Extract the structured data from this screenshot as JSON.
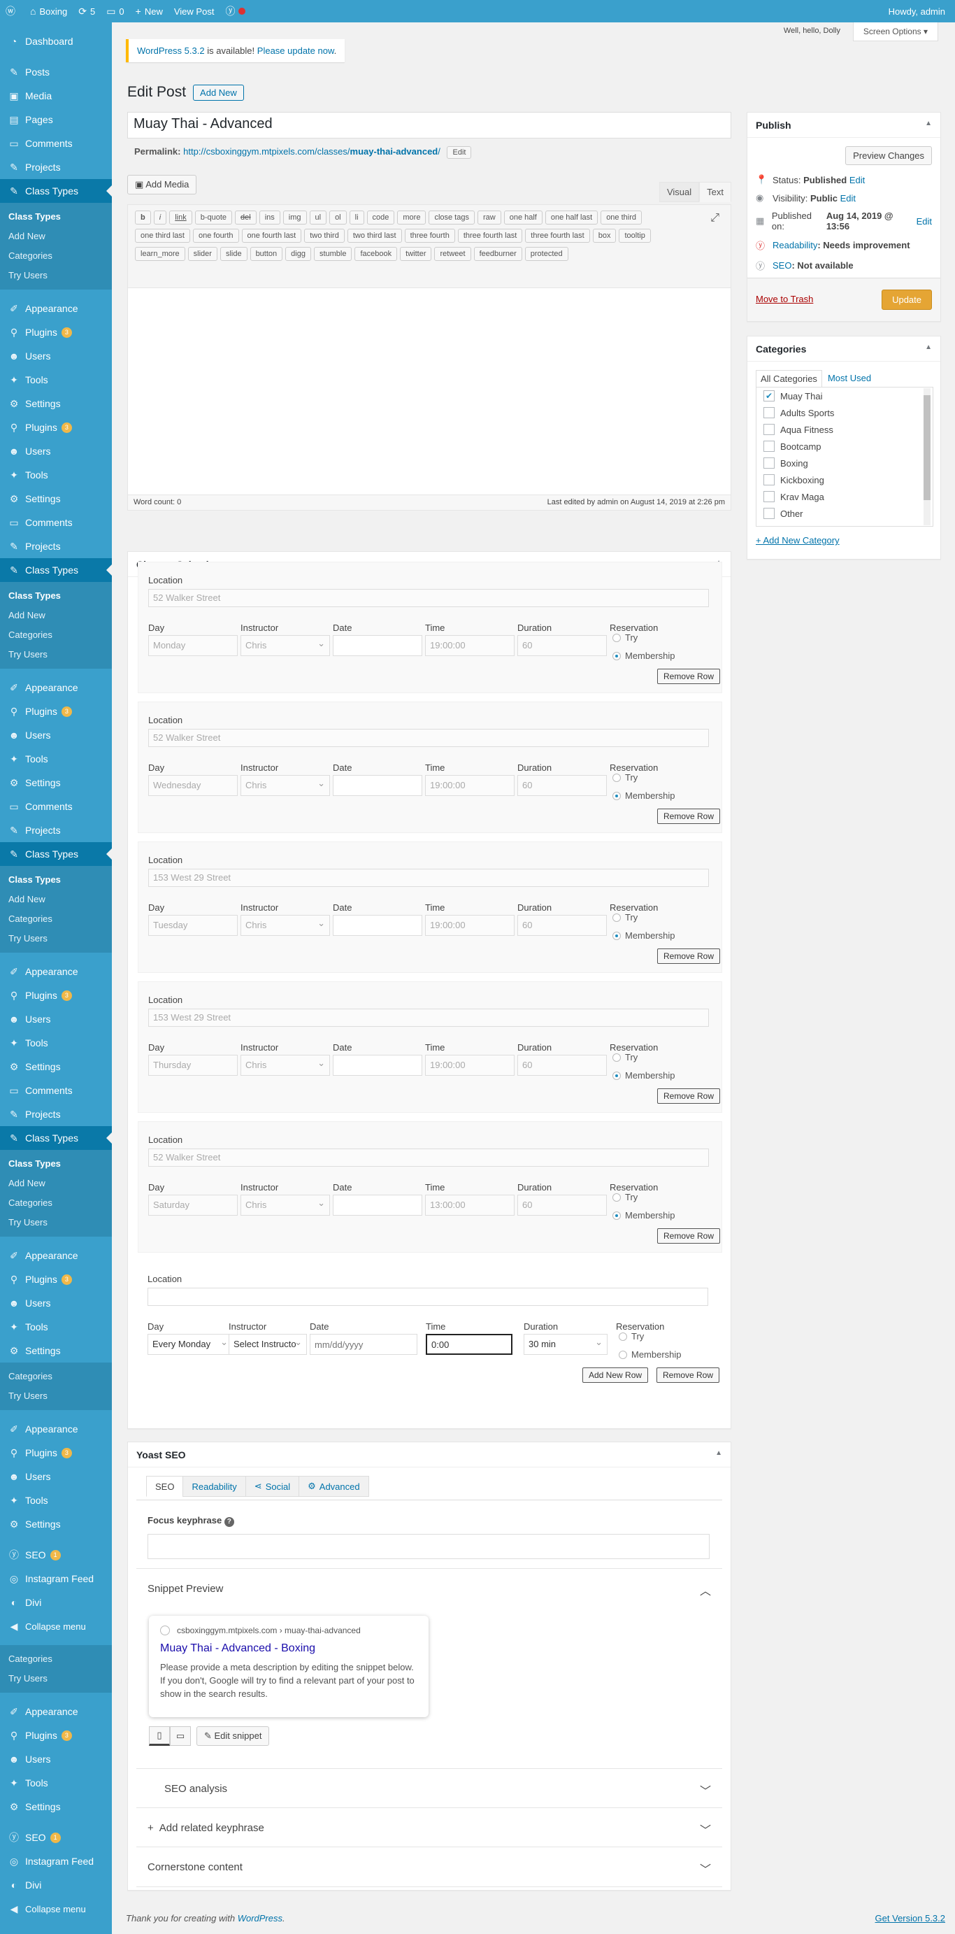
{
  "adminbar": {
    "site_name": "Boxing",
    "updates_count": "5",
    "comments_count": "0",
    "new_label": "New",
    "view_post_label": "View Post",
    "howdy": "Howdy, admin"
  },
  "sidebar": {
    "dashboard": "Dashboard",
    "posts": "Posts",
    "media": "Media",
    "pages": "Pages",
    "comments": "Comments",
    "projects": "Projects",
    "class_types": "Class Types",
    "class_types_sub": [
      "Class Types",
      "Add New",
      "Categories",
      "Try Users"
    ],
    "appearance": "Appearance",
    "plugins": "Plugins",
    "plugins_badge": "3",
    "users": "Users",
    "tools": "Tools",
    "settings": "Settings",
    "categories": "Categories",
    "try_users": "Try Users",
    "seo": "SEO",
    "seo_badge": "1",
    "instagram": "Instagram Feed",
    "divi": "Divi",
    "collapse": "Collapse menu"
  },
  "screen": {
    "hello": "Well, hello, Dolly",
    "screen_options": "Screen Options ▾"
  },
  "notice": {
    "link1": "WordPress 5.3.2",
    "middle": "is available!",
    "link2": "Please update now",
    "end": "."
  },
  "page": {
    "title": "Edit Post",
    "add_new": "Add New",
    "post_title": "Muay Thai - Advanced",
    "permalink_label": "Permalink:",
    "permalink_base": "http://csboxinggym.mtpixels.com/classes/",
    "permalink_slug": "muay-thai-advanced",
    "permalink_end": "/",
    "edit": "Edit"
  },
  "editor": {
    "add_media": "Add Media",
    "tab_visual": "Visual",
    "tab_text": "Text",
    "buttons": [
      "b",
      "i",
      "link",
      "b-quote",
      "del",
      "ins",
      "img",
      "ul",
      "ol",
      "li",
      "code",
      "more",
      "close tags",
      "raw",
      "one half",
      "one half last",
      "one third",
      "one third last",
      "one fourth",
      "one fourth last",
      "two third",
      "two third last",
      "three fourth",
      "three fourth last",
      "three fourth last",
      "box",
      "tooltip",
      "learn_more",
      "slider",
      "slide",
      "button",
      "digg",
      "stumble",
      "facebook",
      "twitter",
      "retweet",
      "feedburner",
      "protected"
    ],
    "word_count": "Word count: 0",
    "last_edited": "Last edited by admin on August 14, 2019 at 2:26 pm"
  },
  "calendar": {
    "title": "Classes Calendar",
    "labels": {
      "location": "Location",
      "day": "Day",
      "instructor": "Instructor",
      "date": "Date",
      "time": "Time",
      "duration": "Duration",
      "reservation": "Reservation",
      "try": "Try",
      "membership": "Membership"
    },
    "remove_row": "Remove Row",
    "add_new_row": "Add New Row",
    "rows": [
      {
        "location": "52 Walker Street",
        "day": "Monday",
        "instructor": "Chris",
        "date": "",
        "time": "19:00:00",
        "duration": "60"
      },
      {
        "location": "52 Walker Street",
        "day": "Wednesday",
        "instructor": "Chris",
        "date": "",
        "time": "19:00:00",
        "duration": "60"
      },
      {
        "location": "153 West 29 Street",
        "day": "Tuesday",
        "instructor": "Chris",
        "date": "",
        "time": "19:00:00",
        "duration": "60"
      },
      {
        "location": "153 West 29 Street",
        "day": "Thursday",
        "instructor": "Chris",
        "date": "",
        "time": "19:00:00",
        "duration": "60"
      },
      {
        "location": "52 Walker Street",
        "day": "Saturday",
        "instructor": "Chris",
        "date": "",
        "time": "13:00:00",
        "duration": "60"
      }
    ],
    "new_row": {
      "location": "",
      "day": "Every Monday",
      "instructor": "Select Instructo",
      "date_placeholder": "mm/dd/yyyy",
      "time": "0:00",
      "duration": "30 min"
    }
  },
  "publish": {
    "title": "Publish",
    "preview": "Preview Changes",
    "status_label": "Status:",
    "status_value": "Published",
    "visibility_label": "Visibility:",
    "visibility_value": "Public",
    "published_label": "Published on:",
    "published_value": "Aug 14, 2019 @ 13:56",
    "readability_link": "Readability",
    "readability_value": ": Needs improvement",
    "seo_link": "SEO",
    "seo_value": ": Not available",
    "edit": "Edit",
    "trash": "Move to Trash",
    "update": "Update"
  },
  "categories": {
    "title": "Categories",
    "tab_all": "All Categories",
    "tab_used": "Most Used",
    "items": [
      "Muay Thai",
      "Adults Sports",
      "Aqua Fitness",
      "Bootcamp",
      "Boxing",
      "Kickboxing",
      "Krav Maga",
      "Other"
    ],
    "add_new": "+ Add New Category"
  },
  "yoast": {
    "title": "Yoast SEO",
    "tabs": [
      "SEO",
      "Readability",
      "Social",
      "Advanced"
    ],
    "focus_label": "Focus keyphrase",
    "snippet_title": "Snippet Preview",
    "snippet_url": "csboxinggym.mtpixels.com › muay-thai-advanced",
    "snippet_link": "Muay Thai - Advanced - Boxing",
    "snippet_desc": "Please provide a meta description by editing the snippet below. If you don't, Google will try to find a relevant part of your post to show in the search results.",
    "edit_snippet": "Edit snippet",
    "seo_analysis": "SEO analysis",
    "related": "Add related keyphrase",
    "cornerstone": "Cornerstone content"
  },
  "footer": {
    "thanks": "Thank you for creating with",
    "wp": "WordPress",
    "dot": ".",
    "version": "Get Version 5.3.2"
  }
}
